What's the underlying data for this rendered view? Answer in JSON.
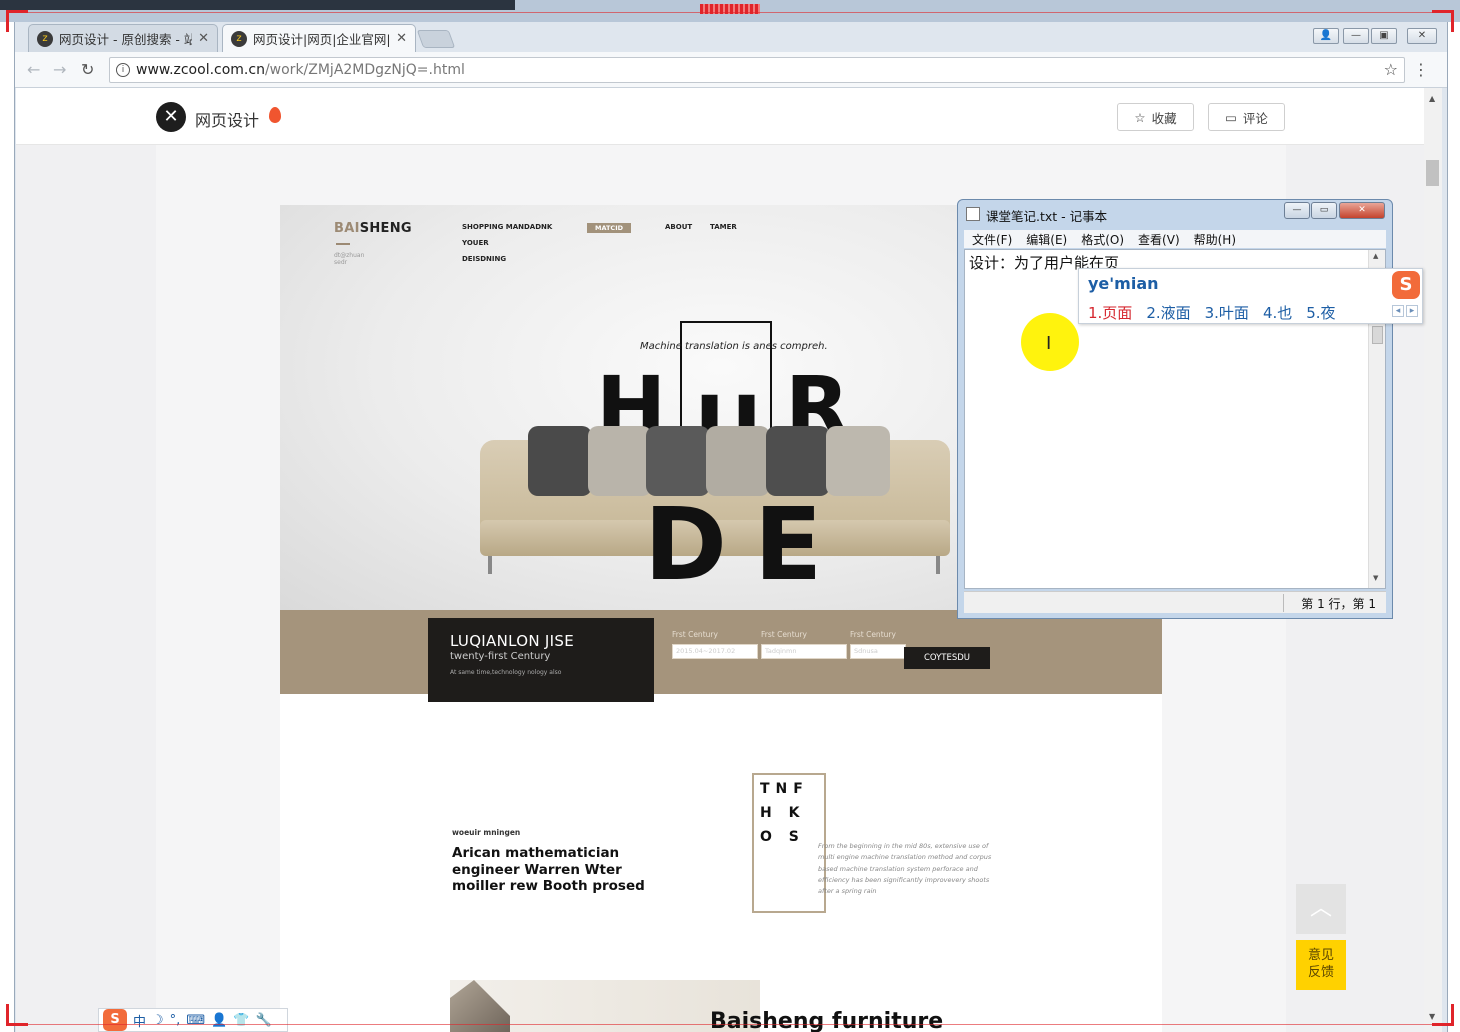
{
  "browser": {
    "tabs": [
      {
        "label": "网页设计 - 原创搜索 - 站"
      },
      {
        "label": "网页设计|网页|企业官网|"
      }
    ],
    "url_host": "www.zcool.com.cn",
    "url_path": "/work/ZMjA2MDgzNjQ=.html"
  },
  "page": {
    "title": "网页设计",
    "collect_label": "收藏",
    "comment_label": "评论",
    "to_top": "︿",
    "feedback_line1": "意见",
    "feedback_line2": "反馈"
  },
  "design": {
    "brand_a": "BAI",
    "brand_b": "SHENG",
    "brand_sub": "dt@zhuan sedr",
    "nav": [
      "SHOPPING MANDADNK",
      "YOUER",
      "DEISDNING",
      "MATCID",
      "ABOUT",
      "TAMER"
    ],
    "tagline": "Machine translation is anes compreh.",
    "big_letters": [
      "H",
      "U",
      "R",
      "D",
      "E"
    ],
    "bar_title": "LUQIANLON JISE",
    "bar_subtitle": "twenty-first Century",
    "bar_small": "At same time,technology nology also",
    "fields": [
      {
        "label": "Frst Century",
        "value": "2015.04~2017.02"
      },
      {
        "label": "Frst Century",
        "value": "Tadqinmn"
      },
      {
        "label": "Frst Century",
        "value": "Sdnusa"
      }
    ],
    "button": "COYTESDU",
    "s2_small": "woeuir mningen",
    "s2_heading": "Arican mathematician engineer Warren Wter moiller rew Booth prosed",
    "tnf_rows": [
      "TNF",
      "H K",
      "O S"
    ],
    "s2_paragraph": "From the beginning in the mid 80s, extensive use of multi engine machine translation method and corpus based machine translation system perforace and efficiency has been significantly improvevery shoots after a spring rain",
    "s3_title": "Baisheng furniture"
  },
  "notepad": {
    "title": "课堂笔记.txt - 记事本",
    "menu": [
      "文件(F)",
      "编辑(E)",
      "格式(O)",
      "查看(V)",
      "帮助(H)"
    ],
    "text": "设计：为了用户能在页",
    "status": "第 1 行，第 1"
  },
  "ime": {
    "pinyin": "ye'mian",
    "candidates": [
      "1.页面",
      "2.液面",
      "3.叶面",
      "4.也",
      "5.夜"
    ],
    "bar_items": [
      "中",
      "☽",
      "°,",
      "⌨",
      "👤",
      "👕",
      "🔧"
    ]
  },
  "colors": {
    "accent": "#a5947c",
    "highlight": "#fff200",
    "feedback": "#ffd100"
  }
}
